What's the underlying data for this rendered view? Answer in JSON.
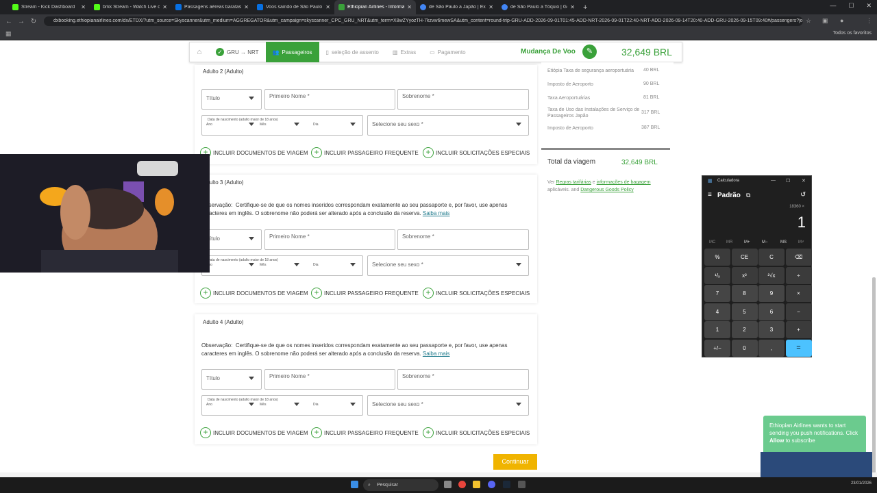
{
  "browser": {
    "tabs": [
      "Stream - Kick Dashboard",
      "brkk Stream - Watch Live on Ki",
      "Passagens aéreas baratas: com",
      "Voos saindo de São Paulo para",
      "Ethiopian Airlines - Informaçõ",
      "de São Paulo a Japão | Explore",
      "de São Paulo a Tóquio | Googl"
    ],
    "url": "dxbooking.ethiopianairlines.com/dx/ETDX/?utm_source=Skyscanner&utm_medium=AGGREGATOR&utm_campaign=skyscanner_CPC_GRU_NRT&utm_term=X8wZYyozTH-7kzvw6mewSA&utm_content=round-trip-GRU-ADD-2026-09-01T01:45-ADD-NRT-2026-09-01T22:40-NRT-ADD-2026-09-14T20:40-ADD-GRU-2026-09-15T09:40#/passengers?journe...",
    "favorites": "Todos os favoritos"
  },
  "steps": {
    "route": "GRU → NRT",
    "passengers": "Passageiros",
    "seat": "seleção de assento",
    "extras": "Extras",
    "payment": "Pagamento"
  },
  "header": {
    "change_flight": "Mudança De Voo",
    "total": "32,649 BRL"
  },
  "form": {
    "adult2": "Adulto 2 (Adulto)",
    "adult3": "Adulto 3 (Adulto)",
    "adult4": "Adulto 4 (Adulto)",
    "title_placeholder": "Título",
    "first_name": "Primeiro Nome *",
    "last_name": "Sobrenome *",
    "dob_label": "Data de nascimento (adulto maior de 18 anos)",
    "year": "Ano",
    "month": "Mês",
    "day": "Dia",
    "gender": "Selecione seu sexo *",
    "note_prefix": "Observação:",
    "note": "Certifique-se de que os nomes inseridos correspondam exatamente ao seu passaporte e, por favor, use apenas caracteres em inglês. O sobrenome não poderá ser alterado após a conclusão da reserva.",
    "learn_more": "Saiba mais",
    "docs": "INCLUIR DOCUMENTOS DE VIAGEM",
    "ff": "INCLUIR PASSAGEIRO FREQUENTE",
    "special": "INCLUIR SOLICITAÇÕES ESPECIAIS",
    "continue": "Continuar"
  },
  "fees": [
    {
      "label": "Etiópia Taxa de segurança aeroportuária",
      "value": "40 BRL"
    },
    {
      "label": "Imposto de Aeroporto",
      "value": "90 BRL"
    },
    {
      "label": "Taxa Aeroportuárias",
      "value": "81 BRL"
    },
    {
      "label": "Taxa de Uso das Instalações de Serviço de Passageiros Japão",
      "value": "317 BRL"
    },
    {
      "label": "Imposto de Aeroporto",
      "value": "387 BRL"
    }
  ],
  "summary": {
    "total_label": "Total da viagem",
    "total_value": "32,649 BRL",
    "see": "Ver",
    "rules": "Regras tarifárias",
    "and": "e",
    "baggage": "informações de bagagem",
    "applicable": "aplicáveis. and",
    "dgp": "Dangerous Goods Policy"
  },
  "calculator": {
    "title": "Calculadora",
    "mode": "Padrão",
    "expression": "18360 ×",
    "display": "1",
    "memory": [
      "MC",
      "MR",
      "M+",
      "M−",
      "MS",
      "M˅"
    ],
    "keys": [
      [
        "%",
        "CE",
        "C",
        "⌫"
      ],
      [
        "¹/ₓ",
        "x²",
        "²√x",
        "÷"
      ],
      [
        "7",
        "8",
        "9",
        "×"
      ],
      [
        "4",
        "5",
        "6",
        "−"
      ],
      [
        "1",
        "2",
        "3",
        "+"
      ],
      [
        "+/−",
        "0",
        ",",
        "="
      ]
    ]
  },
  "notification": {
    "text1": "Ethiopian Airlines wants to start sending you push notifications. Click ",
    "allow": "Allow",
    "text2": " to subscribe"
  },
  "taskbar": {
    "search": "Pesquisar",
    "date": "23/01/2026"
  }
}
